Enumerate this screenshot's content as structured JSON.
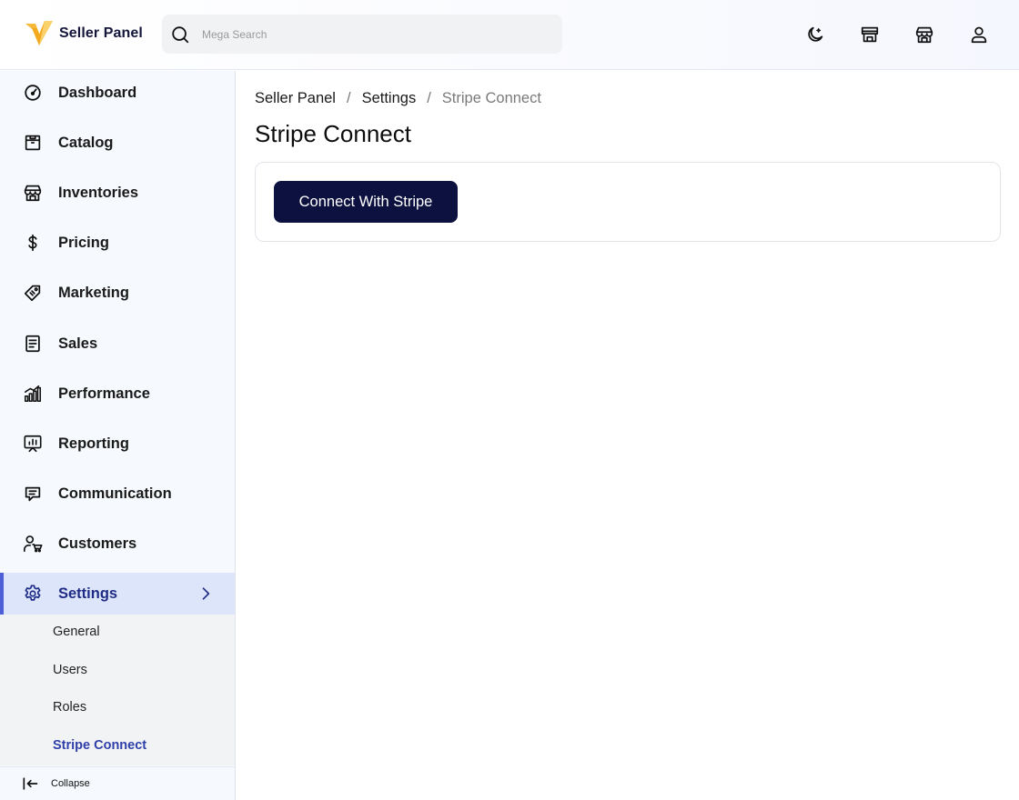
{
  "header": {
    "brand_name": "Seller Panel",
    "search_placeholder": "Mega Search",
    "icons": [
      "moon-icon",
      "store-icon",
      "warehouse-icon",
      "user-icon"
    ]
  },
  "sidebar": {
    "items": [
      {
        "label": "Dashboard",
        "icon": "dashboard-icon"
      },
      {
        "label": "Catalog",
        "icon": "catalog-icon"
      },
      {
        "label": "Inventories",
        "icon": "inventories-icon"
      },
      {
        "label": "Pricing",
        "icon": "dollar-icon"
      },
      {
        "label": "Marketing",
        "icon": "tag-icon"
      },
      {
        "label": "Sales",
        "icon": "document-icon"
      },
      {
        "label": "Performance",
        "icon": "bar-chart-icon"
      },
      {
        "label": "Reporting",
        "icon": "presentation-icon"
      },
      {
        "label": "Communication",
        "icon": "chat-icon"
      },
      {
        "label": "Customers",
        "icon": "customer-cart-icon"
      },
      {
        "label": "Settings",
        "icon": "gear-icon",
        "active": true
      }
    ],
    "settings_sub": [
      {
        "label": "General"
      },
      {
        "label": "Users"
      },
      {
        "label": "Roles"
      },
      {
        "label": "Stripe Connect",
        "active": true
      }
    ],
    "collapse_label": "Collapse"
  },
  "breadcrumb": [
    "Seller Panel",
    "Settings",
    "Stripe Connect"
  ],
  "breadcrumb_sep": "/",
  "page": {
    "title": "Stripe Connect",
    "connect_button": "Connect With Stripe"
  },
  "colors": {
    "brand_navy": "#0d1140",
    "active_accent": "#4c5fd6",
    "active_bg": "#dde5fb",
    "logo_yellow": "#f6b93b"
  }
}
